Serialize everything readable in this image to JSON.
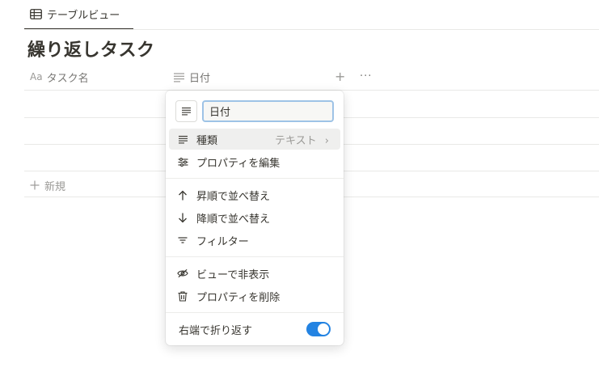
{
  "view_tab": {
    "icon": "table-icon",
    "label": "テーブルビュー"
  },
  "page": {
    "title": "繰り返しタスク"
  },
  "table": {
    "columns": [
      {
        "icon": "aa-text-icon",
        "icon_text": "Aa",
        "label": "タスク名"
      },
      {
        "icon": "lines-icon",
        "label": "日付"
      }
    ],
    "add_column": "+",
    "more": "···",
    "new_row_label": "新規"
  },
  "menu": {
    "name_input": {
      "value": "日付"
    },
    "items": [
      {
        "icon": "lines-icon",
        "label": "種類",
        "value": "テキスト"
      },
      {
        "icon": "sliders-icon",
        "label": "プロパティを編集"
      },
      {
        "icon": "arrow-up-icon",
        "label": "昇順で並べ替え"
      },
      {
        "icon": "arrow-down-icon",
        "label": "降順で並べ替え"
      },
      {
        "icon": "filter-icon",
        "label": "フィルター"
      },
      {
        "icon": "eye-off-icon",
        "label": "ビューで非表示"
      },
      {
        "icon": "trash-icon",
        "label": "プロパティを削除"
      }
    ],
    "wrap": {
      "label": "右端で折り返す",
      "enabled": true
    }
  },
  "colors": {
    "accent": "#2383e2",
    "text": "#37352f",
    "muted": "#9b9a97"
  }
}
